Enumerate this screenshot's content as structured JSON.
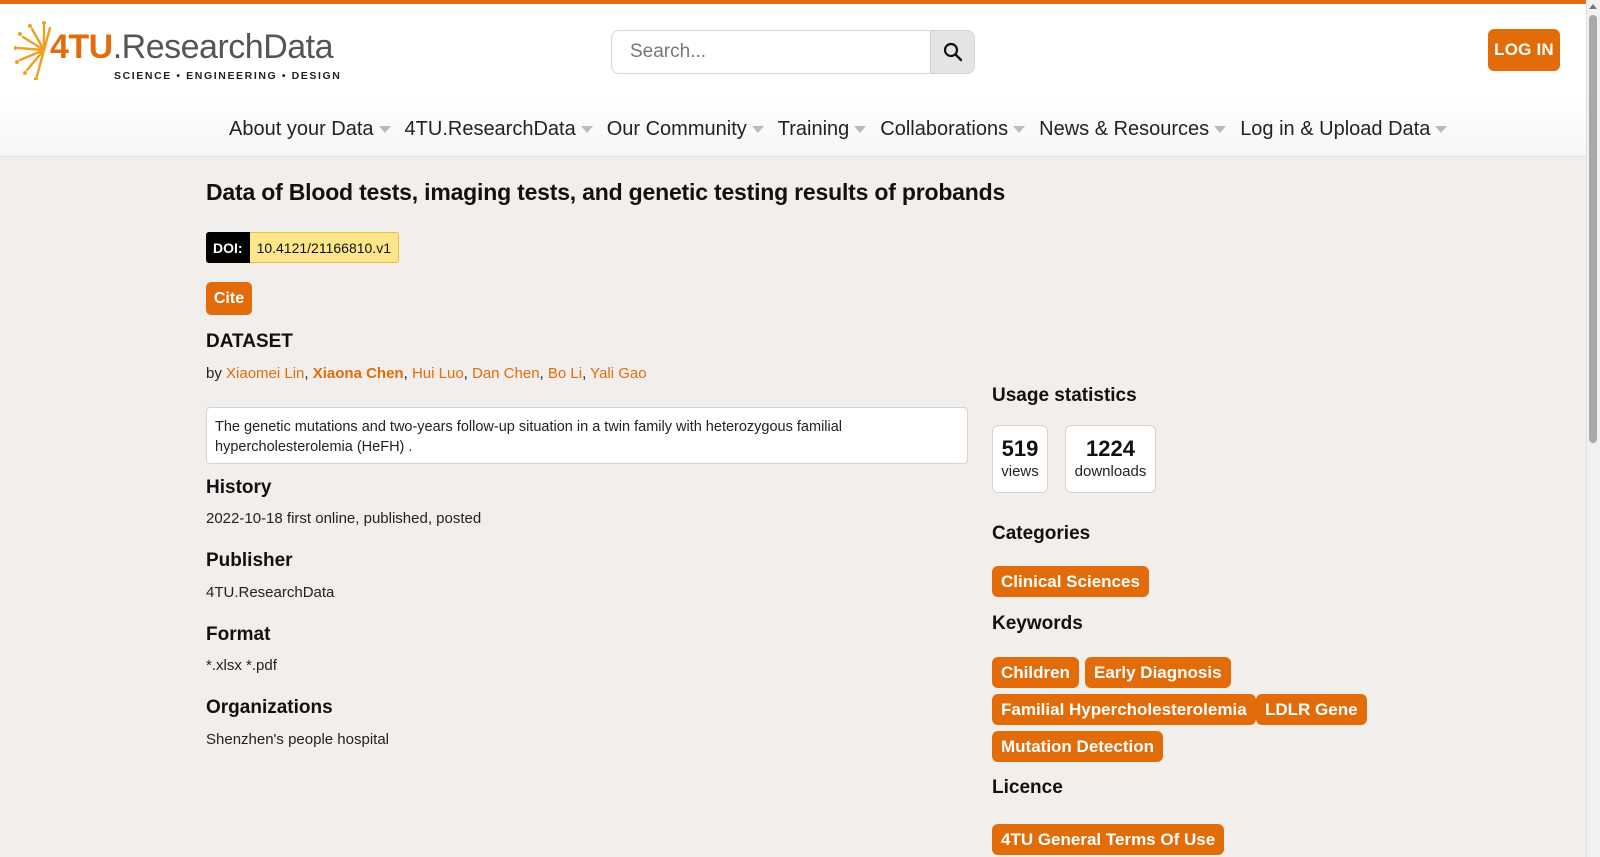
{
  "header": {
    "logo": {
      "brand_orange": "4TU",
      "brand_grey": ".ResearchData",
      "tagline": "SCIENCE • ENGINEERING • DESIGN"
    },
    "search": {
      "placeholder": "Search..."
    },
    "login_label": "LOG IN"
  },
  "nav": [
    {
      "label": "About your Data"
    },
    {
      "label": "4TU.ResearchData"
    },
    {
      "label": "Our Community"
    },
    {
      "label": "Training"
    },
    {
      "label": "Collaborations"
    },
    {
      "label": "News & Resources"
    },
    {
      "label": "Log in & Upload Data"
    }
  ],
  "dataset": {
    "title": "Data of Blood tests, imaging tests, and genetic testing results of probands",
    "doi_label": "DOI:",
    "doi_value": "10.4121/21166810.v1",
    "cite_label": "Cite",
    "type_label": "DATASET",
    "by_label": "by",
    "authors": [
      "Xiaomei Lin",
      "Xiaona Chen",
      "Hui Luo",
      "Dan Chen",
      "Bo Li",
      "Yali Gao"
    ],
    "description": "The genetic mutations and two-years follow-up situation in a twin family with heterozygous familial hypercholesterolemia (HeFH) .",
    "history_heading": "History",
    "history_value": "2022-10-18 first online, published, posted",
    "publisher_heading": "Publisher",
    "publisher_value": "4TU.ResearchData",
    "format_heading": "Format",
    "format_value": "*.xlsx *.pdf",
    "organizations_heading": "Organizations",
    "organizations_value": "Shenzhen's people hospital"
  },
  "sidebar": {
    "usage_heading": "Usage statistics",
    "views_count": "519",
    "views_label": "views",
    "downloads_count": "1224",
    "downloads_label": "downloads",
    "categories_heading": "Categories",
    "categories": [
      "Clinical Sciences"
    ],
    "keywords_heading": "Keywords",
    "keywords": [
      "Children",
      "Early Diagnosis",
      "Familial Hypercholesterolemia",
      "LDLR Gene",
      "Mutation Detection"
    ],
    "licence_heading": "Licence",
    "licence": "4TU General Terms Of Use"
  },
  "colors": {
    "accent": "#e36c0a",
    "doi_bg": "#fde68a",
    "page_bg": "#f1eeec"
  }
}
